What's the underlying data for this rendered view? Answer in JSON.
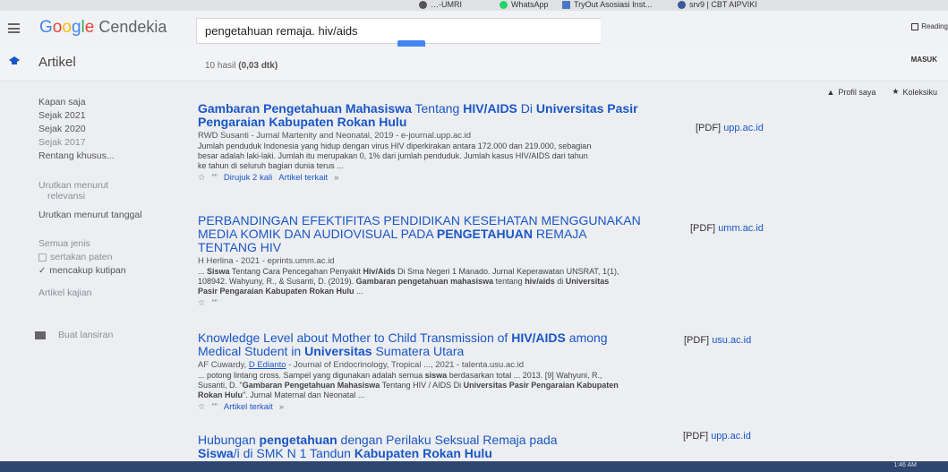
{
  "bookmarks": [
    {
      "label": "…-UMRI",
      "color": "#555555"
    },
    {
      "label": "WhatsApp",
      "color": "#25d366"
    },
    {
      "label": "TryOut Asosiasi Inst...",
      "color": "#4a76c4"
    },
    {
      "label": "srv9 | CBT AIPVIKI",
      "color": "#3b5998"
    }
  ],
  "header": {
    "logo_g": "G",
    "logo_o1": "o",
    "logo_o2": "o",
    "logo_g2": "g",
    "logo_l": "l",
    "logo_e": "e",
    "logo_rest": " Cendekia",
    "search_value": "pengetahuan remaja. hiv/aids",
    "reading_label": "Reading",
    "masuk_label": "MASUK"
  },
  "subheader": {
    "articles_label": "Artikel",
    "results_count": "10 hasil",
    "results_time": "(0,03 dtk)"
  },
  "top_links": {
    "profile": "Profil saya",
    "library": "Koleksiku"
  },
  "sidebar": {
    "any_time": "Kapan saja",
    "since_2021": "Sejak 2021",
    "since_2020": "Sejak 2020",
    "since_2017": "Sejak 2017",
    "custom_range": "Rentang khusus...",
    "sort_relevance_1": "Urutkan menurut",
    "sort_relevance_2": "relevansi",
    "sort_date": "Urutkan menurut tanggal",
    "all_types": "Semua jenis",
    "include_patents": "sertakan paten",
    "include_citations": "mencakup kutipan",
    "review_articles": "Artikel kajian",
    "create_alert": "Buat lansiran"
  },
  "results": [
    {
      "title_html_parts": [
        "Gambaran Pengetahuan Mahasiswa",
        " Tentang ",
        "HIV/AIDS",
        " Di ",
        "Universitas Pasir Pengaraian Kabupaten Rokan Hulu"
      ],
      "meta": "RWD Susanti - Jurnal Martenity and Neonatal, 2019 - e-journal.upp.ac.id",
      "snippet": "Jumlah penduduk Indonesia yang hidup dengan virus HIV diperkirakan antara 172.000 dan 219.000, sebagian besar adalah laki-laki. Jumlah itu merupakan 0, 1% dari jumlah penduduk. Jumlah kasus HIV/AIDS dari tahun ke tahun di seluruh bagian dunia terus ...",
      "cited": "Dirujuk 2 kali",
      "related": "Artikel terkait",
      "pdf_tag": "[PDF]",
      "pdf_source": "upp.ac.id"
    },
    {
      "title_html_parts": [
        "PERBANDINGAN EFEKTIFITAS PENDIDIKAN KESEHATAN MENGGUNAKAN MEDIA KOMIK DAN AUDIOVISUAL PADA ",
        "PENGETAHUAN",
        " REMAJA TENTANG HIV"
      ],
      "meta": "H Herlina - 2021 - eprints.umm.ac.id",
      "snippet_1": "... ",
      "snippet_bold_1": "Siswa",
      "snippet_2": " Tentang Cara Pencegahan Penyakit ",
      "snippet_bold_2": "Hiv/Aids",
      "snippet_3": " Di Sma Negeri 1 Manado. Jurnal Keperawatan UNSRAT, 1(1), 108942. Wahyuny, R., & Susanti, D. (2019). ",
      "snippet_bold_3": "Gambaran pengetahuan mahasiswa",
      "snippet_4": " tentang ",
      "snippet_bold_4": "hiv/aids",
      "snippet_5": " di ",
      "snippet_bold_5": "Universitas Pasir Pengaraian Kabupaten Rokan Hulu",
      "snippet_6": " ...",
      "pdf_tag": "[PDF]",
      "pdf_source": "umm.ac.id"
    },
    {
      "title_1": "Knowledge Level about Mother to Child Transmission of ",
      "title_b1": "HIV/AIDS",
      "title_2": " among Medical Student in ",
      "title_b2": "Universitas",
      "title_3": " Sumatera Utara",
      "meta_1": "AF Cuwardy, ",
      "meta_link": "D Edianto",
      "meta_2": " - Journal of Endocrinology, Tropical ..., 2021 - talenta.usu.ac.id",
      "snippet_1": "... potong lintang cross. Sampel yang digunakan adalah semua ",
      "snippet_b1": "siswa",
      "snippet_2": " berdasarkan total ... 2013. [9] Wahyuni, R., Susanti, D. \"",
      "snippet_b2": "Gambaran Pengetahuan Mahasiswa",
      "snippet_3": " Tentang HIV / AIDS Di ",
      "snippet_b3": "Universitas Pasir Pengaraian Kabupaten Rokan Hulu",
      "snippet_4": "\". Jurnal Maternal dan Neonatal ...",
      "related": "Artikel terkait",
      "pdf_tag": "[PDF]",
      "pdf_source": "usu.ac.id"
    },
    {
      "title_1": "Hubungan ",
      "title_b1": "pengetahuan",
      "title_2": " dengan Perilaku Seksual Remaja pada ",
      "title_b2": "Siswa",
      "title_3": "/i di SMK N 1 Tandun ",
      "title_b3": "Kabupaten Rokan Hulu",
      "pdf_tag": "[PDF]",
      "pdf_source": "upp.ac.id"
    }
  ],
  "taskbar": {
    "clock": "1:46 AM"
  },
  "colors": {
    "link": "#1a56c7",
    "accent": "#4285f4",
    "meta": "#2b6a2b"
  }
}
